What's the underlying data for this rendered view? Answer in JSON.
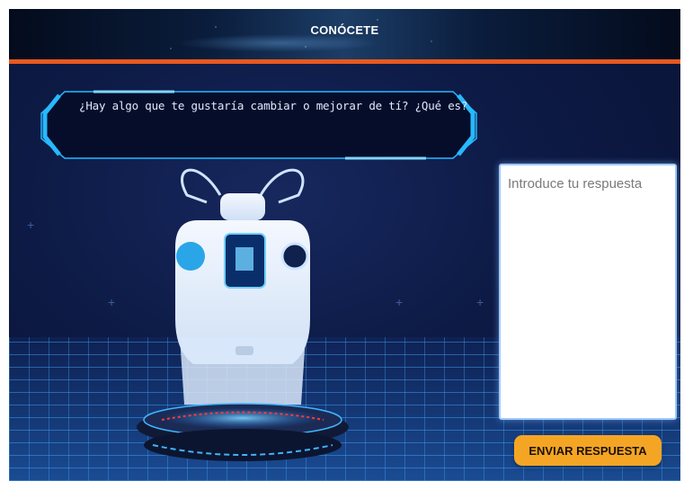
{
  "header": {
    "title": "CONÓCETE"
  },
  "question": {
    "text": "¿Hay algo que te gustaría cambiar o mejorar de tí? ¿Qué es?"
  },
  "answer": {
    "placeholder": "Introduce tu respuesta",
    "value": ""
  },
  "submit": {
    "label": "ENVIAR RESPUESTA"
  },
  "colors": {
    "accent": "#e8591f",
    "button": "#f5a524",
    "frame": "#27b8ff",
    "background": "#0d1a45"
  }
}
